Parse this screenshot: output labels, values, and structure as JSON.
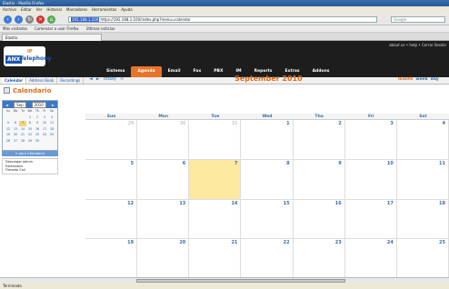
{
  "window": {
    "title": "Elastix - Mozilla Firefox"
  },
  "menu": [
    "Archivo",
    "Editar",
    "Ver",
    "Historial",
    "Marcadores",
    "Herramientas",
    "Ayuda"
  ],
  "toolbar": {
    "url_highlight": "192.168.1.100",
    "url": "https://192.168.1.100/index.php?menu=calendar",
    "search_placeholder": "Google"
  },
  "bookmarks": [
    "Más visitados",
    "Comenzar a usar Firefox",
    "Últimas noticias"
  ],
  "tab": {
    "title": "Elastix"
  },
  "header": {
    "logo_anx": "ANX",
    "logo_telephony": "Telephony",
    "logo_ip": "IP",
    "user_links": "about us  •  help  •  Cerrar Sesión",
    "modules": [
      "Sistema",
      "Agenda",
      "Email",
      "Fax",
      "PBX",
      "IM",
      "Reports",
      "Extras",
      "Addons"
    ],
    "active_module": "Agenda"
  },
  "subtabs": [
    "Calendar",
    "Address Book",
    "Recordings"
  ],
  "page_title": "Calendario",
  "mini_calendar": {
    "month": "Sep",
    "year": "2010",
    "day_headers": [
      "Su",
      "Mo",
      "Tu",
      "We",
      "Th",
      "Fr",
      "Sa"
    ],
    "days": [
      "",
      "",
      "",
      "1",
      "2",
      "3",
      "4",
      "5",
      "6",
      "7",
      "8",
      "9",
      "10",
      "11",
      "12",
      "13",
      "14",
      "15",
      "16",
      "17",
      "18",
      "19",
      "20",
      "21",
      "22",
      "23",
      "24",
      "25",
      "26",
      "27",
      "28",
      "29",
      "30",
      "",
      ""
    ],
    "today": "7",
    "today_button": "Ir para Calendario",
    "today_list": [
      "Descargar admin",
      "Extensions",
      "Firmado Call"
    ]
  },
  "calendar": {
    "nav": [
      "◄",
      "►",
      "today",
      "↻"
    ],
    "title": "September 2010",
    "views": [
      "month",
      "week",
      "day"
    ],
    "columns": [
      "Sun",
      "Mon",
      "Tue",
      "Wed",
      "Thu",
      "Fri",
      "Sat"
    ],
    "weeks": [
      [
        {
          "d": "29",
          "other": true
        },
        {
          "d": "30",
          "other": true
        },
        {
          "d": "31",
          "other": true
        },
        {
          "d": "1"
        },
        {
          "d": "2"
        },
        {
          "d": "3"
        },
        {
          "d": "4"
        }
      ],
      [
        {
          "d": "5"
        },
        {
          "d": "6"
        },
        {
          "d": "7",
          "today": true
        },
        {
          "d": "8"
        },
        {
          "d": "9"
        },
        {
          "d": "10"
        },
        {
          "d": "11"
        }
      ],
      [
        {
          "d": "12"
        },
        {
          "d": "13"
        },
        {
          "d": "14"
        },
        {
          "d": "15"
        },
        {
          "d": "16"
        },
        {
          "d": "17"
        },
        {
          "d": "18"
        }
      ],
      [
        {
          "d": "19"
        },
        {
          "d": "20"
        },
        {
          "d": "21"
        },
        {
          "d": "22"
        },
        {
          "d": "23"
        },
        {
          "d": "24"
        },
        {
          "d": "25"
        }
      ]
    ]
  },
  "status": "Terminado",
  "colors": {
    "accent": "#e8742a",
    "link": "#3a6ea5",
    "today": "#fde8a0"
  }
}
